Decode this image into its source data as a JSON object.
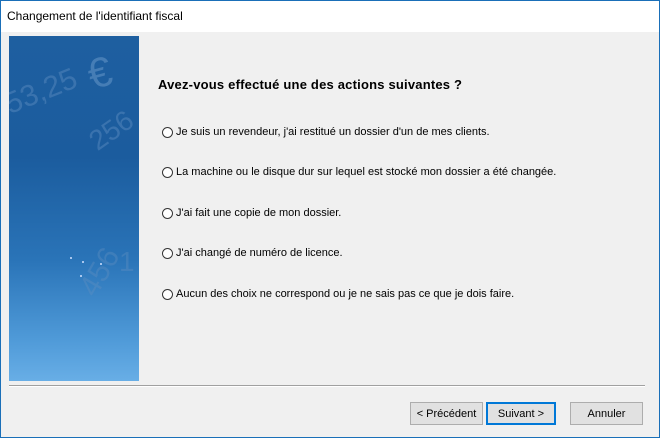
{
  "window": {
    "title": "Changement de l'identifiant fiscal"
  },
  "side_panel": {
    "decor_numbers": [
      "53,25",
      "€",
      "256",
      "456",
      "1"
    ]
  },
  "main": {
    "heading": "Avez-vous effectué une des actions suivantes ?",
    "options": [
      {
        "label": "Je suis un revendeur, j'ai restitué un dossier d'un de mes clients.",
        "selected": false
      },
      {
        "label": "La machine ou le disque dur sur lequel est stocké mon dossier a été changée.",
        "selected": false
      },
      {
        "label": "J'ai fait une copie de mon dossier.",
        "selected": false
      },
      {
        "label": "J'ai changé de numéro de licence.",
        "selected": false
      },
      {
        "label": "Aucun des choix ne correspond ou je ne sais pas ce que je dois faire.",
        "selected": false
      }
    ]
  },
  "buttons": {
    "previous": "< Précédent",
    "next": "Suivant >",
    "cancel": "Annuler"
  }
}
